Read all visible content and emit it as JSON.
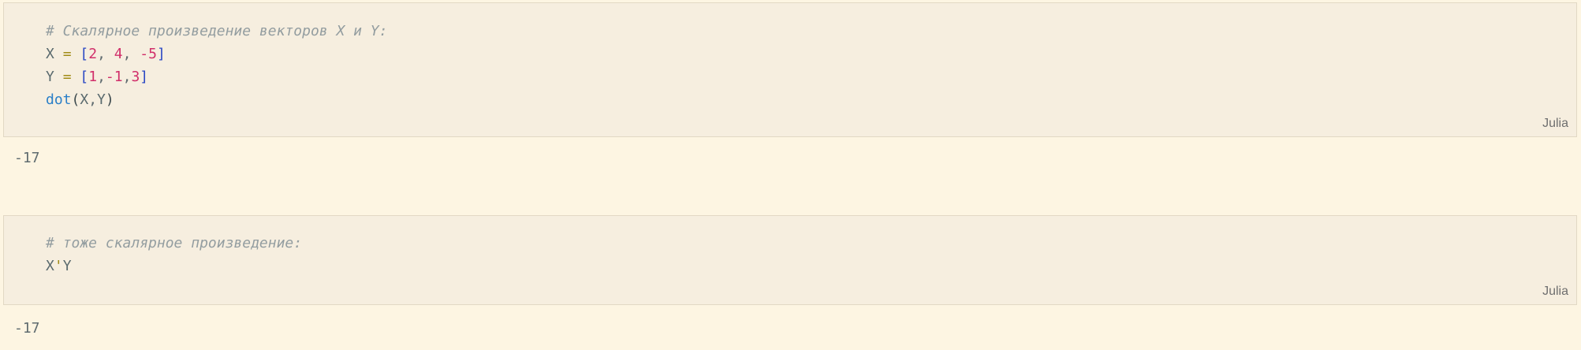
{
  "cells": [
    {
      "language": "Julia",
      "lines": [
        [
          {
            "t": "# Скалярное произведение векторов X и Y:",
            "k": "comment"
          }
        ],
        [
          {
            "t": "X",
            "k": "ident"
          },
          {
            "t": " ",
            "k": "punct"
          },
          {
            "t": "=",
            "k": "op"
          },
          {
            "t": " ",
            "k": "punct"
          },
          {
            "t": "[",
            "k": "bracket"
          },
          {
            "t": "2",
            "k": "num"
          },
          {
            "t": ", ",
            "k": "punct"
          },
          {
            "t": "4",
            "k": "num"
          },
          {
            "t": ", ",
            "k": "punct"
          },
          {
            "t": "-5",
            "k": "num"
          },
          {
            "t": "]",
            "k": "bracket"
          }
        ],
        [
          {
            "t": "Y",
            "k": "ident"
          },
          {
            "t": " ",
            "k": "punct"
          },
          {
            "t": "=",
            "k": "op"
          },
          {
            "t": " ",
            "k": "punct"
          },
          {
            "t": "[",
            "k": "bracket"
          },
          {
            "t": "1",
            "k": "num"
          },
          {
            "t": ",",
            "k": "punct"
          },
          {
            "t": "-1",
            "k": "num"
          },
          {
            "t": ",",
            "k": "punct"
          },
          {
            "t": "3",
            "k": "num"
          },
          {
            "t": "]",
            "k": "bracket"
          }
        ],
        [
          {
            "t": "dot",
            "k": "func"
          },
          {
            "t": "(",
            "k": "paren"
          },
          {
            "t": "X",
            "k": "ident"
          },
          {
            "t": ",",
            "k": "punct"
          },
          {
            "t": "Y",
            "k": "ident"
          },
          {
            "t": ")",
            "k": "paren"
          }
        ]
      ],
      "output": "-17"
    },
    {
      "language": "Julia",
      "lines": [
        [
          {
            "t": "# тоже скалярное произведение:",
            "k": "comment"
          }
        ],
        [
          {
            "t": "X",
            "k": "ident"
          },
          {
            "t": "'",
            "k": "quote"
          },
          {
            "t": "Y",
            "k": "ident"
          }
        ]
      ],
      "output": "-17"
    }
  ]
}
